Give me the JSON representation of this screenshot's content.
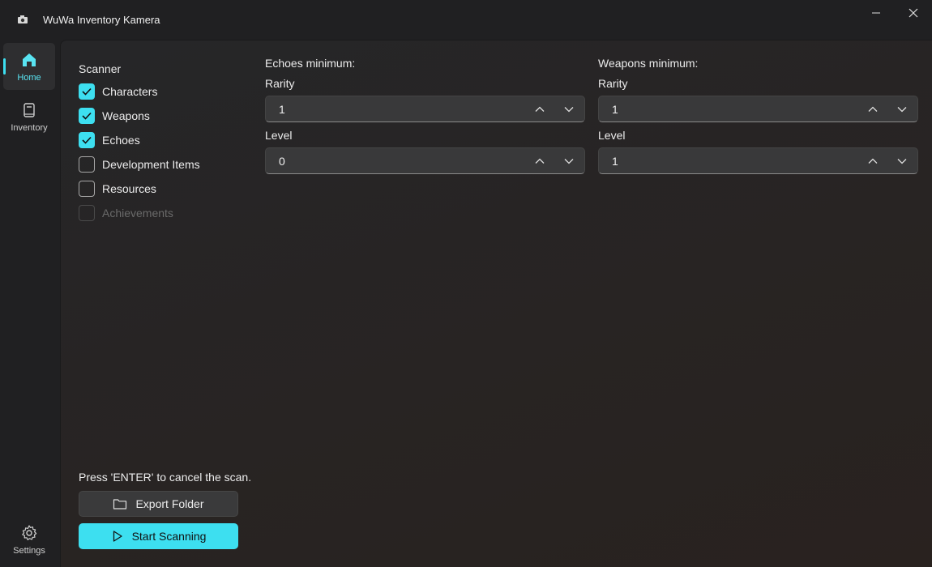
{
  "app": {
    "title": "WuWa Inventory Kamera"
  },
  "nav": {
    "home": "Home",
    "inventory": "Inventory",
    "settings": "Settings"
  },
  "scanner": {
    "title": "Scanner",
    "items": [
      {
        "label": "Characters",
        "checked": true,
        "disabled": false
      },
      {
        "label": "Weapons",
        "checked": true,
        "disabled": false
      },
      {
        "label": "Echoes",
        "checked": true,
        "disabled": false
      },
      {
        "label": "Development Items",
        "checked": false,
        "disabled": false
      },
      {
        "label": "Resources",
        "checked": false,
        "disabled": false
      },
      {
        "label": "Achievements",
        "checked": false,
        "disabled": true
      }
    ]
  },
  "echoes": {
    "title": "Echoes minimum:",
    "rarity_label": "Rarity",
    "rarity_value": "1",
    "level_label": "Level",
    "level_value": "0"
  },
  "weapons": {
    "title": "Weapons minimum:",
    "rarity_label": "Rarity",
    "rarity_value": "1",
    "level_label": "Level",
    "level_value": "1"
  },
  "footer": {
    "hint": "Press 'ENTER' to cancel the scan.",
    "export_label": "Export Folder",
    "start_label": "Start Scanning"
  },
  "colors": {
    "accent": "#3ddff0"
  }
}
